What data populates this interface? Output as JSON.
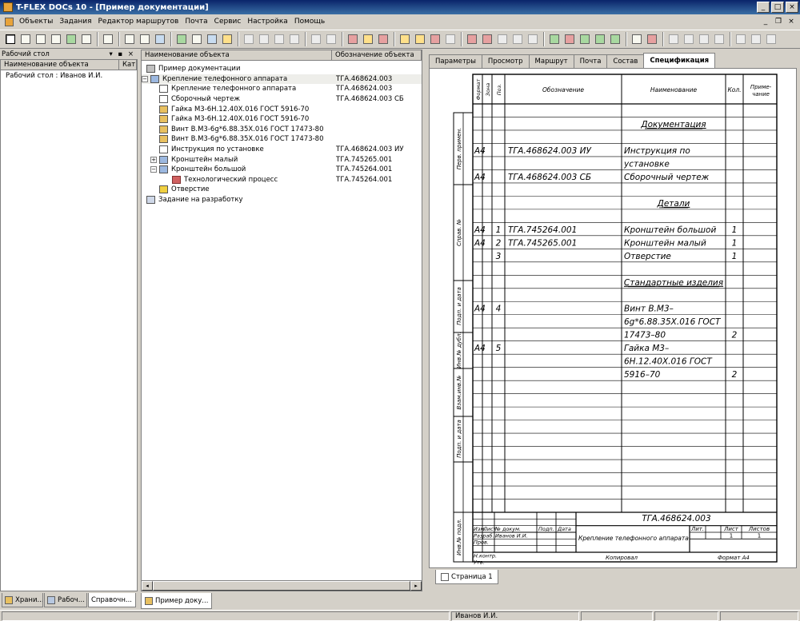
{
  "window": {
    "title": "T-FLEX DOCs 10 - [Пример документации]"
  },
  "menu": [
    "Объекты",
    "Задания",
    "Редактор маршрутов",
    "Почта",
    "Сервис",
    "Настройка",
    "Помощь"
  ],
  "left_panel": {
    "header": "Рабочий стол",
    "pin": "▾ ▪ ×",
    "col_name": "Наименование объекта",
    "col_cat": "Кат",
    "row": "Рабочий стол : Иванов И.И.",
    "bottom_tabs": [
      "Храни...",
      "Рабоч...",
      "Справочн..."
    ]
  },
  "mid_panel": {
    "col_name": "Наименование объекта",
    "col_code": "Обозначение объекта",
    "tab": "Пример доку...",
    "tree": [
      {
        "level": 0,
        "icon": "root",
        "label": "Пример документации",
        "code": ""
      },
      {
        "level": 0,
        "icon": "asm",
        "label": "Крепление телефонного аппарата",
        "code": "ТГА.468624.003",
        "expander": "−"
      },
      {
        "level": 1,
        "icon": "doc",
        "label": "Крепление телефонного аппарата",
        "code": "ТГА.468624.003"
      },
      {
        "level": 1,
        "icon": "doc",
        "label": "Сборочный чертеж",
        "code": "ТГА.468624.003 СБ"
      },
      {
        "level": 1,
        "icon": "part",
        "label": "Гайка М3-6Н.12.40Х.016 ГОСТ 5916-70",
        "code": ""
      },
      {
        "level": 1,
        "icon": "part",
        "label": "Гайка М3-6Н.12.40Х.016 ГОСТ 5916-70",
        "code": ""
      },
      {
        "level": 1,
        "icon": "part",
        "label": "Винт В.М3-6g*6.88.35Х.016 ГОСТ 17473-80",
        "code": ""
      },
      {
        "level": 1,
        "icon": "part",
        "label": "Винт В.М3-6g*6.88.35Х.016 ГОСТ 17473-80",
        "code": ""
      },
      {
        "level": 1,
        "icon": "doc",
        "label": "Инструкция по установке",
        "code": "ТГА.468624.003 ИУ"
      },
      {
        "level": 1,
        "icon": "asm",
        "label": "Кронштейн малый",
        "code": "ТГА.745265.001",
        "expander": "+"
      },
      {
        "level": 1,
        "icon": "asm",
        "label": "Кронштейн большой",
        "code": "ТГА.745264.001",
        "expander": "−"
      },
      {
        "level": 2,
        "icon": "proc",
        "label": "Технологический процесс",
        "code": "ТГА.745264.001"
      },
      {
        "level": 1,
        "icon": "hole",
        "label": "Отверстие",
        "code": ""
      },
      {
        "level": 0,
        "icon": "task",
        "label": "Задание на разработку",
        "code": ""
      }
    ]
  },
  "right_panel": {
    "tabs": [
      "Параметры",
      "Просмотр",
      "Маршрут",
      "Почта",
      "Состав",
      "Спецификация"
    ],
    "active_tab": "Спецификация",
    "page_tab": "Страница 1",
    "spec": {
      "headers": {
        "format": "Формат",
        "zone": "Зона",
        "pos": "Поз.",
        "designation": "Обозначение",
        "name": "Наименование",
        "qty": "Кол.",
        "note": "Приме-чание"
      },
      "side_labels": [
        "Перв. примен.",
        "Справ. №",
        "Подп. и дата",
        "Инв.№ дубл.",
        "Взам.инв.№",
        "Подп. и дата",
        "Инв.№ подл."
      ],
      "rows": [
        {
          "format": "",
          "pos": "",
          "designation": "",
          "name": "",
          "qty": ""
        },
        {
          "format": "",
          "pos": "",
          "designation": "",
          "name": "Документация",
          "qty": "",
          "section": true
        },
        {
          "format": "",
          "pos": "",
          "designation": "",
          "name": "",
          "qty": ""
        },
        {
          "format": "А4",
          "pos": "",
          "designation": "ТГА.468624.003 ИУ",
          "name": "Инструкция по",
          "qty": ""
        },
        {
          "format": "",
          "pos": "",
          "designation": "",
          "name": "установке",
          "qty": ""
        },
        {
          "format": "А4",
          "pos": "",
          "designation": "ТГА.468624.003 СБ",
          "name": "Сборочный чертеж",
          "qty": ""
        },
        {
          "format": "",
          "pos": "",
          "designation": "",
          "name": "",
          "qty": ""
        },
        {
          "format": "",
          "pos": "",
          "designation": "",
          "name": "Детали",
          "qty": "",
          "section": true
        },
        {
          "format": "",
          "pos": "",
          "designation": "",
          "name": "",
          "qty": ""
        },
        {
          "format": "А4",
          "pos": "1",
          "designation": "ТГА.745264.001",
          "name": "Кронштейн большой",
          "qty": "1"
        },
        {
          "format": "А4",
          "pos": "2",
          "designation": "ТГА.745265.001",
          "name": "Кронштейн малый",
          "qty": "1"
        },
        {
          "format": "",
          "pos": "3",
          "designation": "",
          "name": "Отверстие",
          "qty": "1"
        },
        {
          "format": "",
          "pos": "",
          "designation": "",
          "name": "",
          "qty": ""
        },
        {
          "format": "",
          "pos": "",
          "designation": "",
          "name": "Стандартные изделия",
          "qty": "",
          "section": true
        },
        {
          "format": "",
          "pos": "",
          "designation": "",
          "name": "",
          "qty": ""
        },
        {
          "format": "А4",
          "pos": "4",
          "designation": "",
          "name": "Винт В.М3–",
          "qty": ""
        },
        {
          "format": "",
          "pos": "",
          "designation": "",
          "name": "6g*6.88.35Х.016 ГОСТ",
          "qty": ""
        },
        {
          "format": "",
          "pos": "",
          "designation": "",
          "name": "17473–80",
          "qty": "2"
        },
        {
          "format": "А4",
          "pos": "5",
          "designation": "",
          "name": "Гайка М3–",
          "qty": ""
        },
        {
          "format": "",
          "pos": "",
          "designation": "",
          "name": "6Н.12.40Х.016 ГОСТ",
          "qty": ""
        },
        {
          "format": "",
          "pos": "",
          "designation": "",
          "name": "5916–70",
          "qty": "2"
        },
        {
          "format": "",
          "pos": "",
          "designation": "",
          "name": "",
          "qty": ""
        },
        {
          "format": "",
          "pos": "",
          "designation": "",
          "name": "",
          "qty": ""
        },
        {
          "format": "",
          "pos": "",
          "designation": "",
          "name": "",
          "qty": ""
        },
        {
          "format": "",
          "pos": "",
          "designation": "",
          "name": "",
          "qty": ""
        },
        {
          "format": "",
          "pos": "",
          "designation": "",
          "name": "",
          "qty": ""
        },
        {
          "format": "",
          "pos": "",
          "designation": "",
          "name": "",
          "qty": ""
        },
        {
          "format": "",
          "pos": "",
          "designation": "",
          "name": "",
          "qty": ""
        },
        {
          "format": "",
          "pos": "",
          "designation": "",
          "name": "",
          "qty": ""
        },
        {
          "format": "",
          "pos": "",
          "designation": "",
          "name": "",
          "qty": ""
        },
        {
          "format": "",
          "pos": "",
          "designation": "",
          "name": "",
          "qty": ""
        }
      ],
      "titleblock": {
        "designation": "ТГА.468624.003",
        "title": "Крепление телефонного аппарата",
        "col_heads": [
          "Изм.",
          "Лист",
          "№ докум.",
          "Подп.",
          "Дата"
        ],
        "roles": [
          "Разраб.",
          "Пров.",
          "",
          "Н.контр.",
          "Утв."
        ],
        "developer": "Иванов И.И.",
        "lit": "Лит.",
        "sheet": "Лист",
        "sheets": "Листов",
        "sheet_val": "1",
        "sheets_val": "1",
        "copied": "Копировал",
        "format": "Формат А4"
      }
    }
  },
  "status": {
    "user": "Иванов И.И."
  }
}
